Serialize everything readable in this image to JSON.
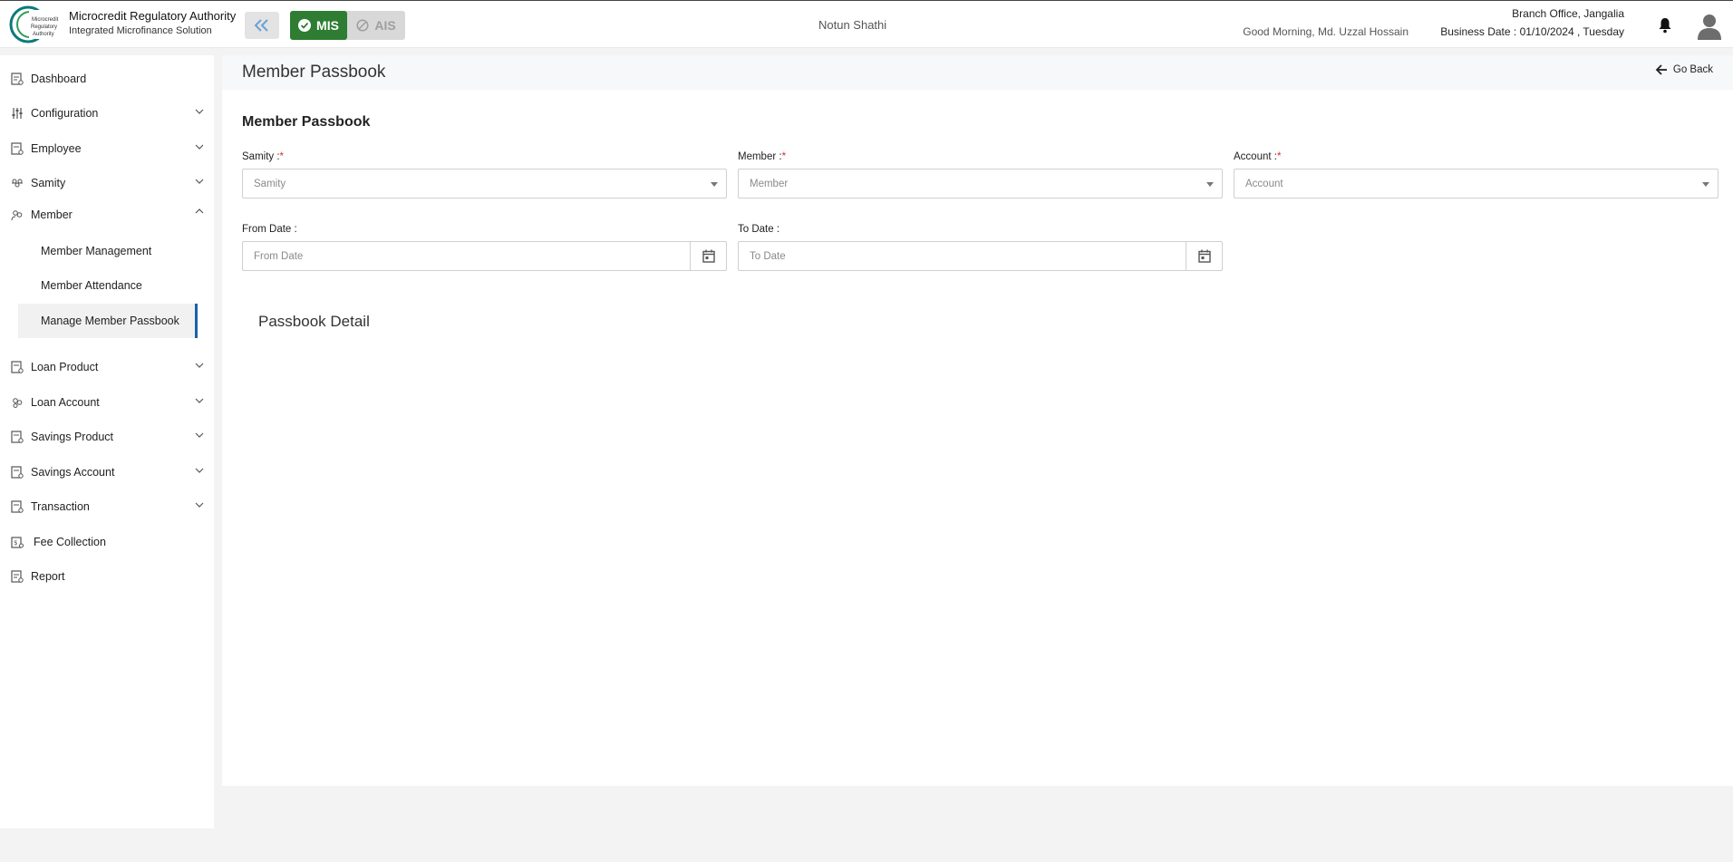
{
  "header": {
    "org_name": "Microcredit Regulatory Authority",
    "org_subtitle": "Integrated Microfinance Solution",
    "logo_text": [
      "Microcredit",
      "Regulatory",
      "Authority"
    ],
    "mode_active": "MIS",
    "mode_inactive": "AIS",
    "center_title": "Notun Shathi",
    "greeting": "Good Morning, Md. Uzzal Hossain",
    "branch": "Branch Office, Jangalia",
    "business_date": "Business Date : 01/10/2024 , Tuesday",
    "icons": [
      "collapse-double-chevron-icon",
      "check-circle-icon",
      "block-icon",
      "bell-icon",
      "user-avatar-icon"
    ]
  },
  "sidebar": {
    "items": [
      {
        "label": "Dashboard",
        "icon": "dashboard-icon",
        "expandable": false
      },
      {
        "label": "Configuration",
        "icon": "sliders-icon",
        "expandable": true
      },
      {
        "label": "Employee",
        "icon": "employee-icon",
        "expandable": true
      },
      {
        "label": "Samity",
        "icon": "group-icon",
        "expandable": true
      },
      {
        "label": "Member",
        "icon": "members-icon",
        "expandable": true,
        "expanded": true
      },
      {
        "label": "Loan Product",
        "icon": "loan-product-icon",
        "expandable": true
      },
      {
        "label": "Loan Account",
        "icon": "loan-account-icon",
        "expandable": true
      },
      {
        "label": "Savings Product",
        "icon": "savings-product-icon",
        "expandable": true
      },
      {
        "label": "Savings Account",
        "icon": "savings-account-icon",
        "expandable": true
      },
      {
        "label": "Transaction",
        "icon": "transaction-icon",
        "expandable": true
      },
      {
        "label": "Fee Collection",
        "icon": "fee-icon",
        "expandable": false
      },
      {
        "label": "Report",
        "icon": "report-icon",
        "expandable": false
      }
    ],
    "member_subitems": [
      {
        "label": "Member Management",
        "active": false
      },
      {
        "label": "Member Attendance",
        "active": false
      },
      {
        "label": "Manage Member Passbook",
        "active": true
      }
    ]
  },
  "page": {
    "title": "Member Passbook",
    "go_back": "Go Back",
    "section_title": "Member Passbook",
    "fields": {
      "samity_label": "Samity :",
      "samity_placeholder": "Samity",
      "member_label": "Member :",
      "member_placeholder": "Member",
      "account_label": "Account :",
      "account_placeholder": "Account",
      "required_mark": "*",
      "from_date_label": "From Date :",
      "from_date_placeholder": "From Date",
      "to_date_label": "To Date :",
      "to_date_placeholder": "To Date"
    },
    "passbook_detail": "Passbook Detail"
  },
  "colors": {
    "accent_green": "#2e7d32",
    "active_indicator": "#1e5fa8",
    "required": "#d32f2f",
    "logo_teal": "#0b7a7a"
  }
}
